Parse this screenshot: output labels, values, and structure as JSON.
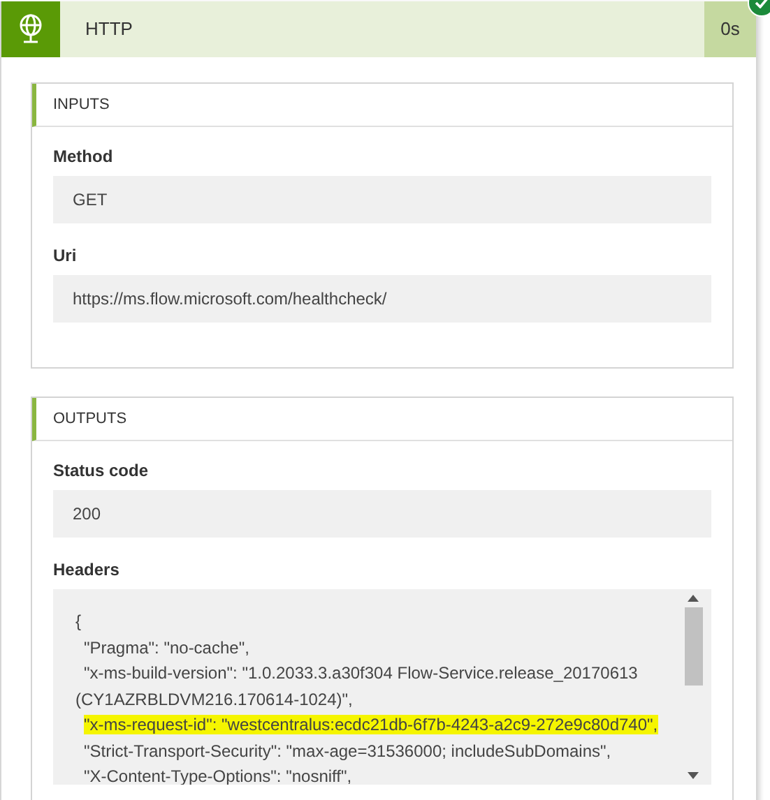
{
  "action": {
    "title": "HTTP",
    "duration": "0s",
    "succeeded": true
  },
  "sections": [
    {
      "title": "INPUTS",
      "fields": [
        {
          "kind": "value",
          "label": "Method",
          "value": "GET"
        },
        {
          "kind": "value",
          "label": "Uri",
          "value": "https://ms.flow.microsoft.com/healthcheck/"
        }
      ]
    },
    {
      "title": "OUTPUTS",
      "fields": [
        {
          "kind": "value",
          "label": "Status code",
          "value": "200"
        },
        {
          "kind": "code",
          "label": "Headers",
          "open": "{",
          "lines": [
            {
              "text": "\"Pragma\": \"no-cache\",",
              "highlighted": false
            },
            {
              "text": "\"x-ms-build-version\": \"1.0.2033.3.a30f304 Flow-Service.release_20170613 (CY1AZRBLDVM216.170614-1024)\",",
              "highlighted": false
            },
            {
              "text": "\"x-ms-request-id\": \"westcentralus:ecdc21db-6f7b-4243-a2c9-272e9c80d740\",",
              "highlighted": true
            },
            {
              "text": "\"Strict-Transport-Security\": \"max-age=31536000; includeSubDomains\",",
              "highlighted": false
            },
            {
              "text": "\"X-Content-Type-Options\": \"nosniff\",",
              "highlighted": false
            }
          ]
        }
      ]
    }
  ]
}
